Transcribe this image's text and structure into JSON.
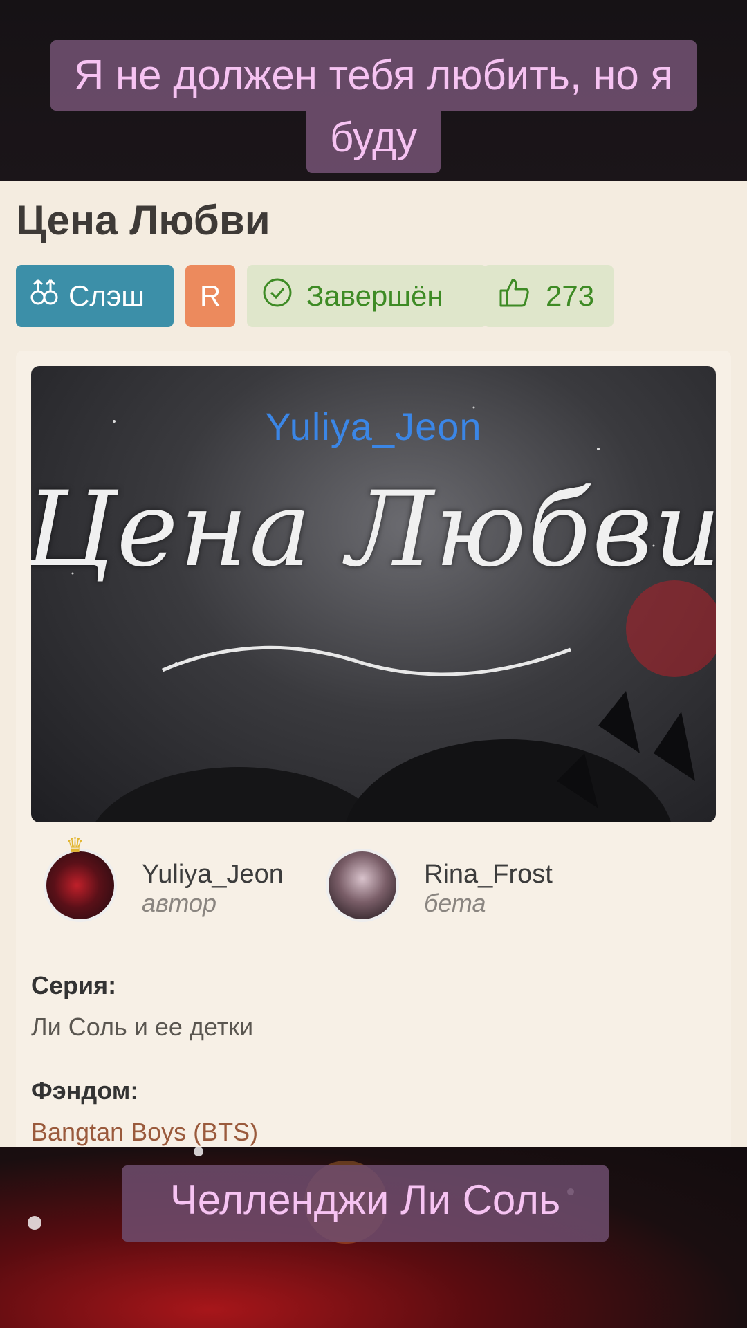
{
  "captions": {
    "top_line1": "Я не должен тебя любить, но я",
    "top_line2": "буду",
    "bottom": "Челленджи Ли Соль"
  },
  "work": {
    "title": "Цена Любви",
    "badges": {
      "direction": "Слэш",
      "direction_icon": "male-male-icon",
      "rating": "R",
      "status": "Завершён",
      "status_icon": "check-circle-icon",
      "likes": "273",
      "likes_icon": "thumbs-up-icon"
    },
    "cover": {
      "author_text": "Yuliya_Jeon",
      "title_text": "Цена Любви"
    },
    "people": [
      {
        "name": "Yuliya_Jeon",
        "role": "автор",
        "badge_icon": "crown-icon"
      },
      {
        "name": "Rina_Frost",
        "role": "бета"
      }
    ],
    "series_label": "Серия:",
    "series_value": "Ли Соль и ее детки",
    "fandom_label": "Фэндом:",
    "fandom_value": "Bangtan Boys (BTS)"
  },
  "colors": {
    "slash_badge": "#3c8fa8",
    "rating_badge": "#ec8a5d",
    "status_badge_bg": "#dfe6cb",
    "status_text": "#3e8b25",
    "caption_text": "#f6c3f2",
    "caption_bg": "#6e4e6e",
    "page_bg": "#f4ece0"
  }
}
